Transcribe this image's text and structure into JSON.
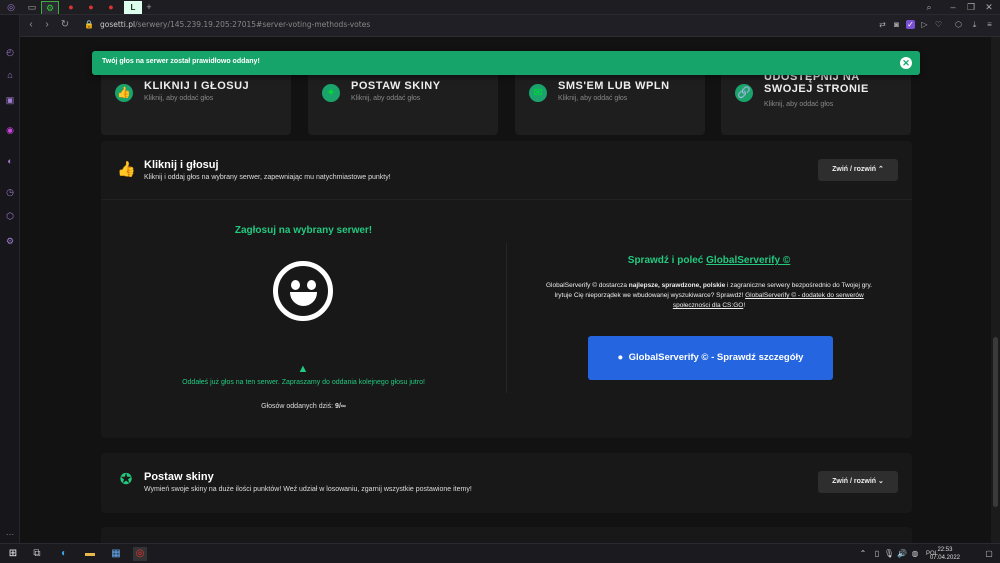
{
  "browser": {
    "url_host": "gosetti.pl",
    "url_path": "/serwery/145.239.19.205:27015#server-voting-methods-votes",
    "tab_add": "+"
  },
  "toast": {
    "message": "Twój głos na serwer został prawidłowo oddany!",
    "close": "✕"
  },
  "methods": [
    {
      "title": "KLIKNIJ I GŁOSUJ",
      "subtitle": "Kliknij, aby oddać głos"
    },
    {
      "title": "POSTAW SKINY",
      "subtitle": "Kliknij, aby oddać głos"
    },
    {
      "title": "SMS'EM LUB WPLN",
      "subtitle": "Kliknij, aby oddać głos"
    },
    {
      "title": "UDOSTĘPNIJ NA SWOJEJ STRONIE",
      "subtitle": "Kliknij, aby oddać głos"
    }
  ],
  "panel_vote": {
    "title": "Kliknij i głosuj",
    "subtitle": "Kliknij i oddaj głos na wybrany serwer, zapewniając mu natychmiastowe punkty!",
    "toggle": "Zwiń / rozwiń",
    "left_heading": "Zagłosuj na wybrany serwer!",
    "warning": "Oddałeś już głos na ten serwer. Zapraszamy do oddania kolejnego głosu jutro!",
    "votes_label": "Głosów oddanych dziś:",
    "votes_value": "9/∞",
    "right_heading_prefix": "Sprawdź i poleć",
    "right_heading_link": "GlobalServerify ©",
    "desc_1a": "GlobalServerify © dostarcza",
    "desc_1b": "najlepsze, sprawdzone, polskie",
    "desc_1c": "i zagraniczne serwery bezpośrednio do Twojej gry.",
    "desc_2a": "Irytuje Cię nieporządek we wbudowanej wyszukiwarce? Sprawdź!",
    "desc_2b": "GlobalServerify © - dodatek do serwerów",
    "desc_2c": "społeczności dla CS:GO",
    "desc_2d": "!",
    "button": "GlobalServerify © - Sprawdź szczegóły"
  },
  "panel_skins": {
    "title": "Postaw skiny",
    "subtitle": "Wymień swoje skiny na duże ilości punktów! Weź udział w losowaniu, zgarnij wszystkie postawione itemy!",
    "toggle": "Zwiń / rozwiń"
  },
  "taskbar": {
    "lang": "POL",
    "time": "22:53",
    "date": "07.04.2022"
  }
}
